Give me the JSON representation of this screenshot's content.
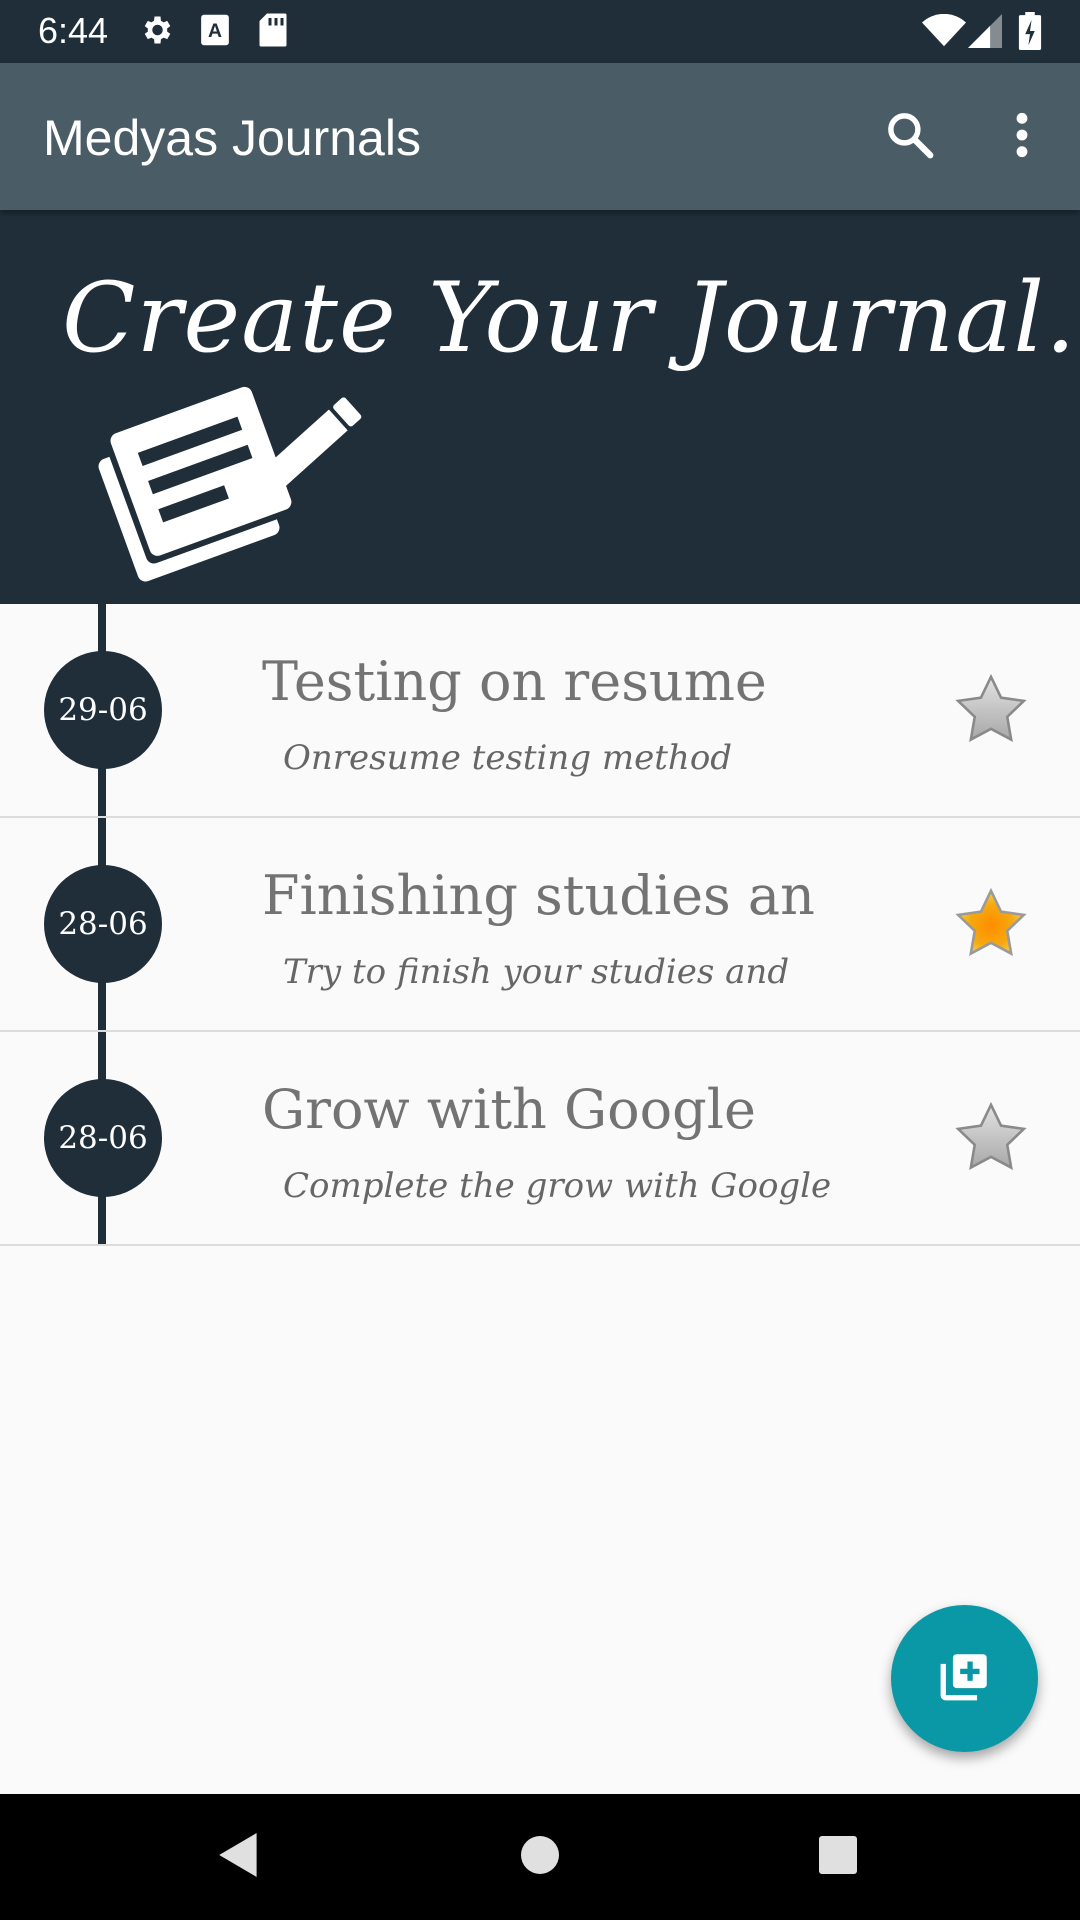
{
  "status_bar": {
    "time": "6:44",
    "icons": [
      "settings-icon",
      "a-icon",
      "sd-card-icon",
      "wifi-icon",
      "signal-icon",
      "battery-icon"
    ]
  },
  "app_bar": {
    "title": "Medyas Journals",
    "actions": [
      "search-icon",
      "more-vert-icon"
    ]
  },
  "banner": {
    "headline": "Create Your Journal.",
    "icon": "journal-edit-icon"
  },
  "journals": [
    {
      "date": "29-06",
      "title": "Testing on resume",
      "subtitle": "Onresume testing method",
      "starred": false
    },
    {
      "date": "28-06",
      "title": "Finishing studies an",
      "subtitle": "Try to finish your studies and",
      "starred": true
    },
    {
      "date": "28-06",
      "title": "Grow with Google",
      "subtitle": "Complete the grow with Google",
      "starred": false
    }
  ],
  "fab": {
    "icon": "add-note-icon"
  },
  "nav_bar": {
    "buttons": [
      "back-icon",
      "home-icon",
      "recents-icon"
    ]
  },
  "colors": {
    "status_bar": "#1f2e39",
    "app_bar": "#4a5c66",
    "banner": "#1f2e39",
    "accent": "#0a97a6",
    "star_active": "#f2a20c",
    "star_inactive": "#bdbdbd"
  }
}
